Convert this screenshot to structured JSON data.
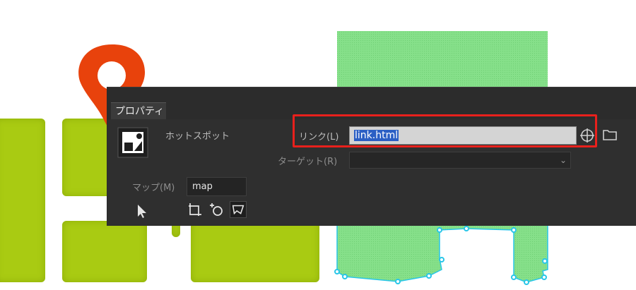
{
  "panel": {
    "tab_label": "プロパティ",
    "hotspot_label": "ホットスポット",
    "link_label": "リンク(L)",
    "link_value": "link.html",
    "target_label": "ターゲット(R)",
    "target_value": "",
    "map_label": "マップ(M)",
    "map_value": "map"
  },
  "icons": {
    "hotspot": "hotspot-image-icon",
    "crosshair": "point-to-file-icon",
    "folder": "folder-icon",
    "dropdown": "chevron-down-icon",
    "pointer": "pointer-hotspot-tool-icon",
    "rect": "rectangle-hotspot-tool-icon",
    "circle": "circle-hotspot-tool-icon",
    "polygon": "polygon-hotspot-tool-icon"
  },
  "colors": {
    "panel_bg": "#2f2f2f",
    "highlight": "#e8201c",
    "selection": "#2b5fc4",
    "lime": "#a9cb12",
    "hotspot_fill": "#86e08a",
    "pin": "#e8420c",
    "handle": "#28c6e8"
  }
}
